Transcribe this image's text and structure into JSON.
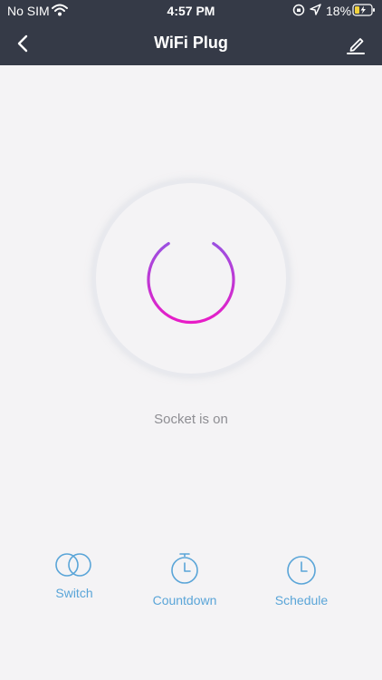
{
  "status_bar": {
    "carrier": "No SIM",
    "time": "4:57 PM",
    "battery": "18%"
  },
  "header": {
    "title": "WiFi Plug",
    "icons": [
      "back-arrow-icon",
      "edit-pencil-icon"
    ]
  },
  "socket": {
    "status_text": "Socket is on",
    "state": "on"
  },
  "actions": [
    {
      "label": "Switch",
      "icon": "switch-toggle-icon"
    },
    {
      "label": "Countdown",
      "icon": "stopwatch-icon"
    },
    {
      "label": "Schedule",
      "icon": "clock-icon"
    }
  ],
  "colors": {
    "header_bg": "#353a47",
    "page_bg": "#f4f3f5",
    "power_gradient_start": "#9b4fe0",
    "power_gradient_end": "#e81cc7",
    "action_color": "#5aa5d8",
    "status_text_color": "#8e8e93"
  }
}
